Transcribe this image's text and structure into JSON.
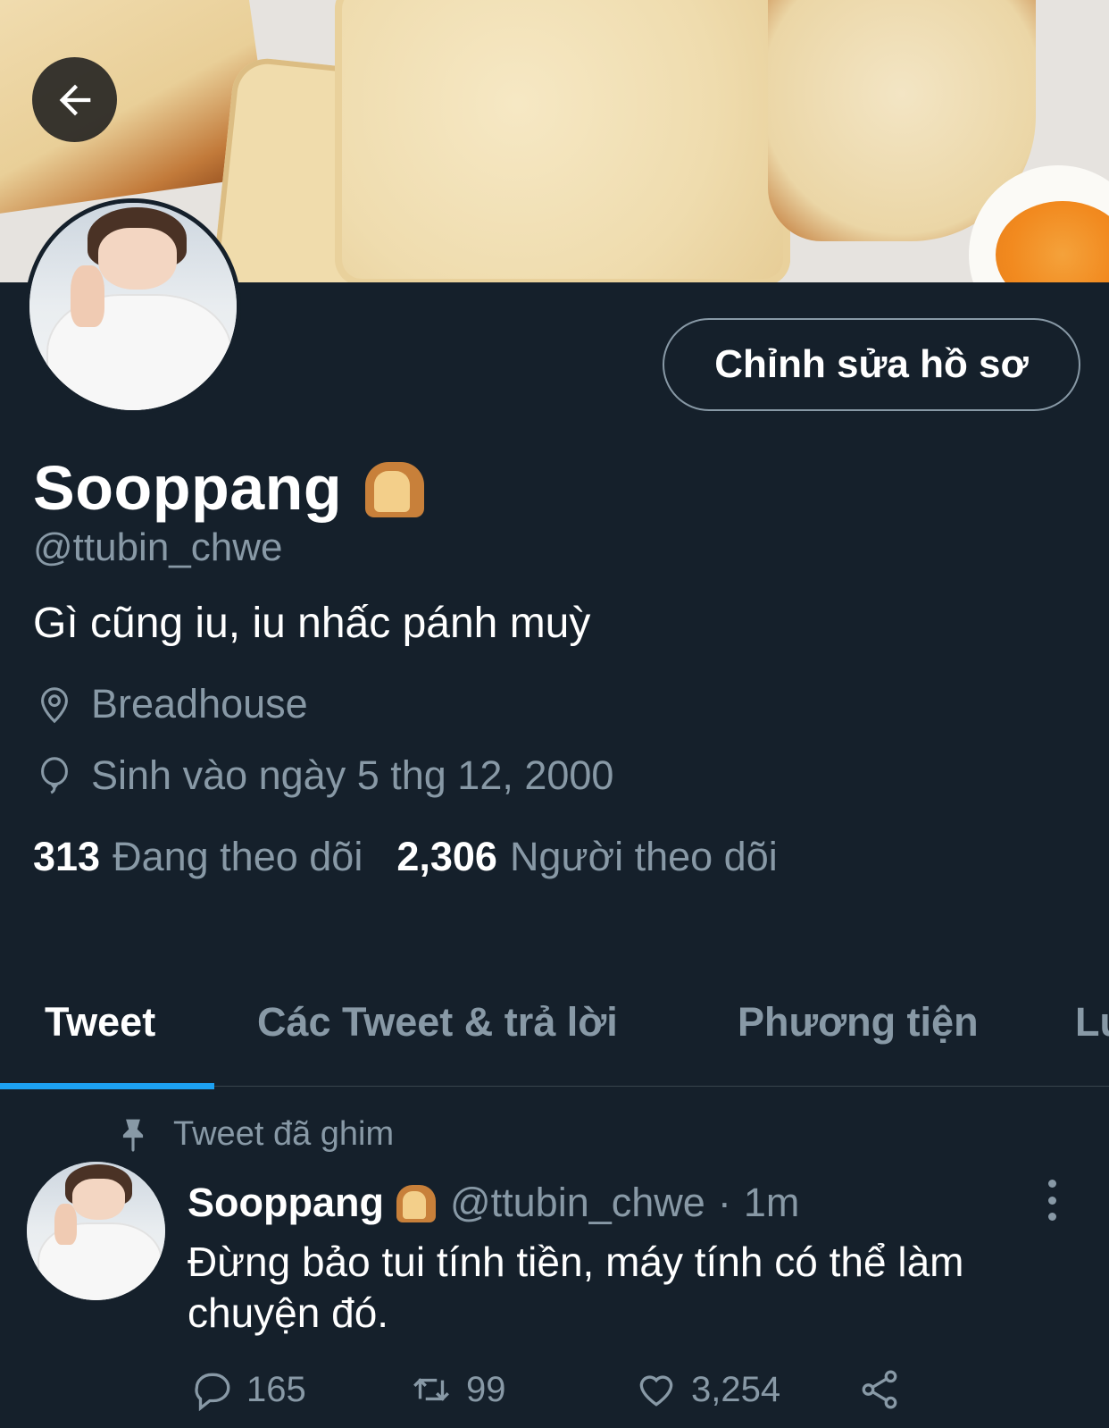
{
  "header": {
    "back_icon": "arrow-left-icon",
    "edit_profile_label": "Chỉnh sửa hồ sơ"
  },
  "profile": {
    "display_name": "Sooppang",
    "name_emoji": "bread-emoji",
    "handle": "@ttubin_chwe",
    "bio": "Gì cũng iu, iu nhấc pánh muỳ",
    "location": "Breadhouse",
    "location_icon": "location-pin-icon",
    "birth": "Sinh vào ngày 5 thg 12, 2000",
    "birth_icon": "balloon-icon",
    "following_count": "313",
    "following_label": "Đang theo dõi",
    "followers_count": "2,306",
    "followers_label": "Người theo dõi"
  },
  "tabs": [
    {
      "label": "Tweet",
      "active": true
    },
    {
      "label": "Các Tweet & trả lời",
      "active": false
    },
    {
      "label": "Phương tiện",
      "active": false
    },
    {
      "label": "Lư",
      "active": false
    }
  ],
  "pinned_tweet": {
    "pinned_label": "Tweet đã ghim",
    "name": "Sooppang",
    "handle": "@ttubin_chwe",
    "separator": "·",
    "time": "1m",
    "text": "Đừng bảo tui tính tiền, máy tính có thể làm chuyện đó.",
    "replies": "165",
    "retweets": "99",
    "likes": "3,254"
  },
  "colors": {
    "background": "#15202b",
    "accent": "#1da1f2",
    "secondary_text": "#8899a6"
  }
}
